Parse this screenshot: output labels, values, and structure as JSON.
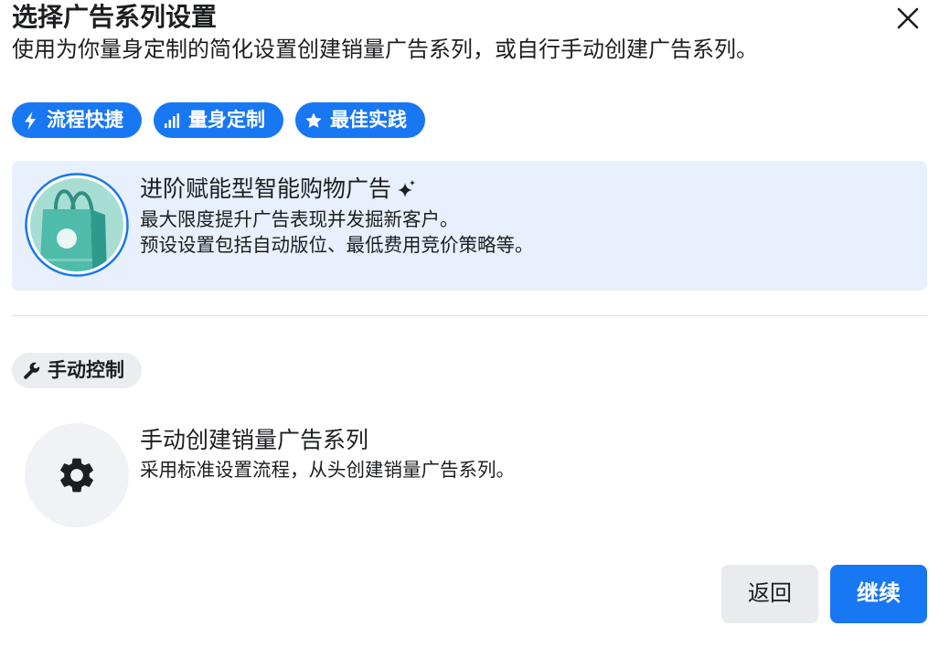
{
  "dialog": {
    "title": "选择广告系列设置",
    "subtitle": "使用为你量身定制的简化设置创建销量广告系列，或自行手动创建广告系列。",
    "close_icon": "close-icon"
  },
  "highlights": [
    {
      "label": "流程快捷",
      "icon": "lightning-icon"
    },
    {
      "label": "量身定制",
      "icon": "bar-chart-icon"
    },
    {
      "label": "最佳实践",
      "icon": "star-icon"
    }
  ],
  "recommended_option": {
    "title": "进阶赋能型智能购物广告",
    "title_icon": "sparkle-icon",
    "description_lines": [
      "最大限度提升广告表现并发掘新客户。",
      "预设设置包括自动版位、最低费用竞价策略等。"
    ],
    "illustration": "shopping-bag-icon",
    "selected": true
  },
  "manual_section": {
    "label": "手动控制",
    "icon": "wrench-icon"
  },
  "manual_option": {
    "title": "手动创建销量广告系列",
    "description": "采用标准设置流程，从头创建销量广告系列。",
    "icon": "gear-icon"
  },
  "footer": {
    "back_label": "返回",
    "continue_label": "继续"
  },
  "colors": {
    "primary": "#1877F2",
    "selected_card_bg": "#E8F0FD",
    "neutral_tag_bg": "#EBEDF0",
    "icon_circle_bg": "#F0F2F5",
    "secondary_button_bg": "#E9EBEE",
    "text": "#1C1E21",
    "bag": "#4FBBAA"
  }
}
